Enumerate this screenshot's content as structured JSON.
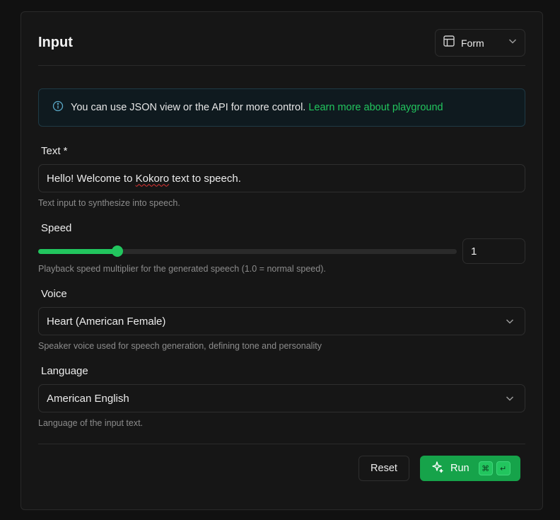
{
  "header": {
    "title": "Input",
    "view_mode": "Form"
  },
  "info": {
    "message": "You can use JSON view or the API for more control.",
    "link": "Learn more about playground"
  },
  "fields": {
    "text": {
      "label": "Text *",
      "value_before": "Hello! Welcome to ",
      "value_misspelled": "Kokoro",
      "value_after": " text to speech.",
      "help": "Text input to synthesize into speech."
    },
    "speed": {
      "label": "Speed",
      "value": "1",
      "slider_fraction": 0.19,
      "help": "Playback speed multiplier for the generated speech (1.0 = normal speed)."
    },
    "voice": {
      "label": "Voice",
      "value": "Heart (American Female)",
      "help": "Speaker voice used for speech generation, defining tone and personality"
    },
    "language": {
      "label": "Language",
      "value": "American English",
      "help": "Language of the input text."
    }
  },
  "actions": {
    "reset_label": "Reset",
    "run_label": "Run",
    "shortcut_keys": [
      "⌘",
      "↵"
    ]
  },
  "colors": {
    "accent": "#22c55e",
    "button": "#16a34a",
    "info_border": "#1f3a45"
  }
}
